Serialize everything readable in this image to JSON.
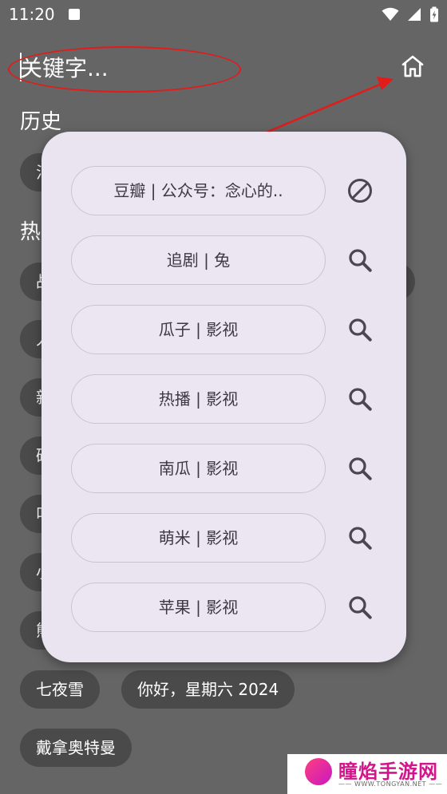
{
  "status_bar": {
    "time": "11:20"
  },
  "search": {
    "placeholder": "关键字..."
  },
  "sections": {
    "history_title": "历史",
    "hot_title": "热"
  },
  "history_chips": [
    "泪"
  ],
  "hot_chips": [
    "战",
    "人",
    "新",
    "碎",
    "叫",
    "小",
    "熊",
    "七夜雪",
    "你好，星期六 2024",
    "戴拿奥特曼"
  ],
  "sources": [
    {
      "label": "豆瓣 | 公众号：念心的..",
      "action_icon": "block-icon"
    },
    {
      "label": "追剧 | 兔",
      "action_icon": "search-icon"
    },
    {
      "label": "瓜子 | 影视",
      "action_icon": "search-icon"
    },
    {
      "label": "热播 | 影视",
      "action_icon": "search-icon"
    },
    {
      "label": "南瓜 | 影视",
      "action_icon": "search-icon"
    },
    {
      "label": "萌米 | 影视",
      "action_icon": "search-icon"
    },
    {
      "label": "苹果 | 影视",
      "action_icon": "search-icon"
    }
  ],
  "watermark": {
    "name": "瞳焰手游网",
    "url": "—— WWW.TONGYAN.NET ——"
  },
  "colors": {
    "backdrop": "#656565",
    "chip": "#4a4a4a",
    "popup": "#e9e4ef",
    "annotation": "#e21b1b",
    "icon": "#4a4653"
  }
}
